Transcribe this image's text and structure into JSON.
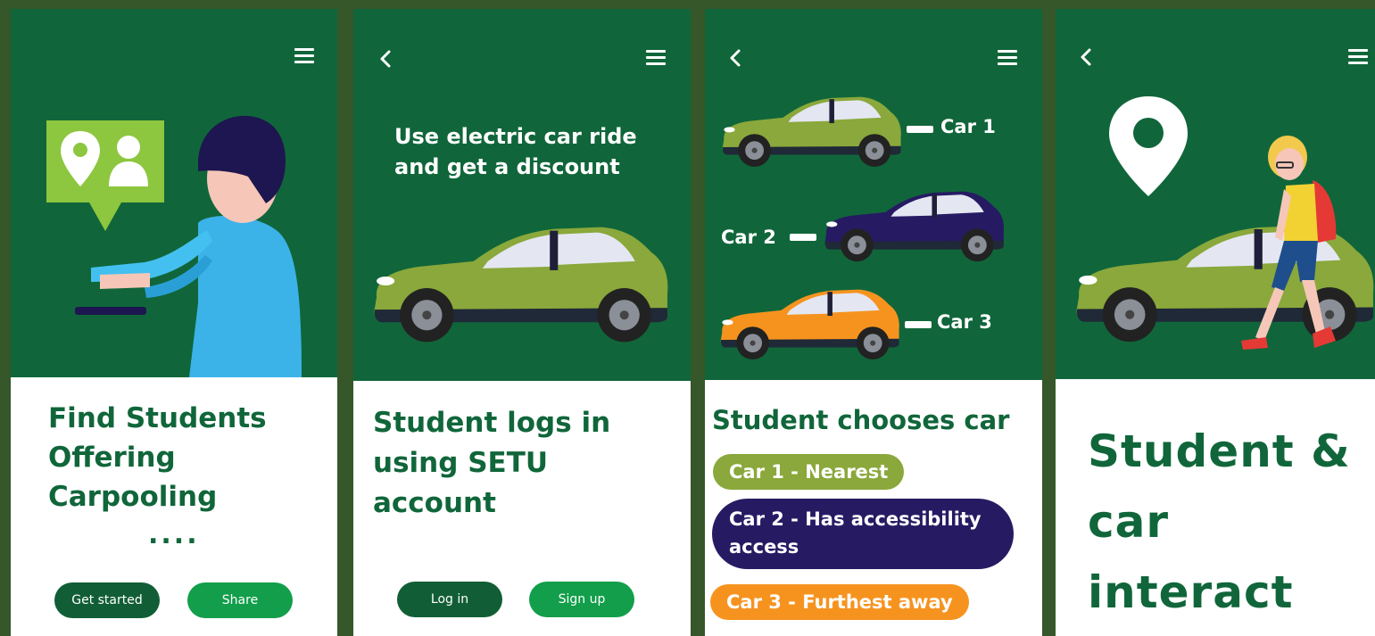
{
  "screen1": {
    "title_lines": [
      "Find Students",
      "Offering",
      "Carpooling"
    ],
    "dots": "....",
    "get_started_label": "Get started",
    "share_label": "Share"
  },
  "screen2": {
    "headline_lines": [
      "Use electric car ride",
      "and get a discount"
    ],
    "title_lines": [
      "Student logs in",
      "using SETU",
      "account"
    ],
    "login_label": "Log in",
    "signup_label": "Sign up"
  },
  "screen3": {
    "car_labels": [
      "Car 1",
      "Car 2",
      "Car 3"
    ],
    "title": "Student chooses car",
    "options": [
      "Car 1 - Nearest",
      "Car 2 - Has accessibility access",
      "Car 3 - Furthest away"
    ]
  },
  "screen4": {
    "title_lines": [
      "Student &",
      "car",
      "interact"
    ]
  },
  "colors": {
    "background": "#35572a",
    "panel_green": "#10663a",
    "car_green": "#8aa83b",
    "car_navy": "#261b63",
    "car_orange": "#f6931f",
    "button_dark": "#115e36",
    "button_light": "#129e4a"
  },
  "icons": [
    "menu-icon",
    "back-icon",
    "location-pin-icon",
    "user-icon",
    "chat-bubble-icon"
  ]
}
